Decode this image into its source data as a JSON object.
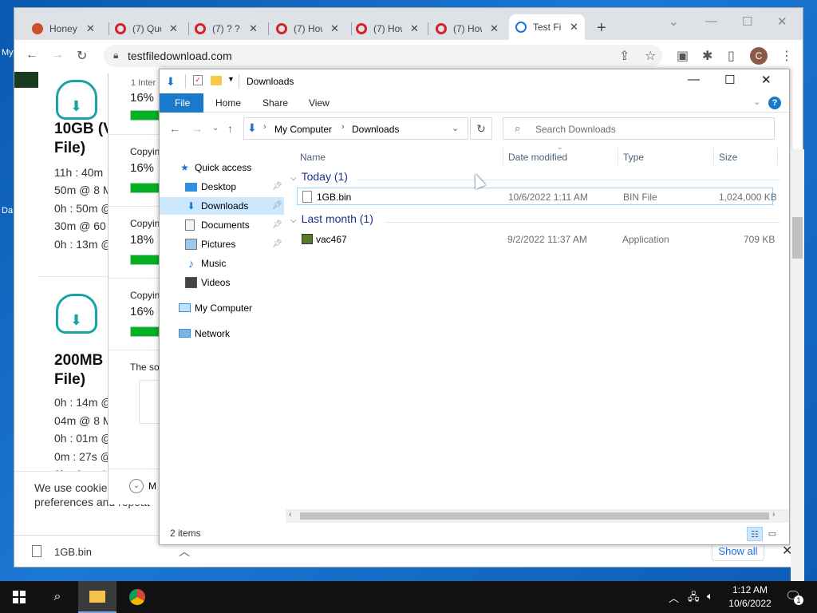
{
  "desktop": {
    "frag1": "My",
    "frag2": "Da"
  },
  "browser": {
    "tabs": [
      {
        "title": "Honey",
        "favicon_color": "#c9502b"
      },
      {
        "title": "(7) Quo",
        "favicon_color": "#d2232a"
      },
      {
        "title": "(7) ? ?",
        "favicon_color": "#d2232a"
      },
      {
        "title": "(7) How",
        "favicon_color": "#d2232a"
      },
      {
        "title": "(7) How",
        "favicon_color": "#d2232a"
      },
      {
        "title": "(7) How",
        "favicon_color": "#d2232a"
      },
      {
        "title": "Test Fil",
        "favicon_color": "#1a73e8"
      }
    ],
    "url": "testfiledownload.com",
    "profile_initial": "C"
  },
  "page": {
    "item1_title_line1": "10GB (V",
    "item1_title_line2": "File)",
    "item1_lines": [
      "11h : 40m",
      "50m @ 8 M",
      "0h : 50m @",
      "30m @ 60",
      "0h : 13m @"
    ],
    "item2_title_line1": "200MB",
    "item2_title_line2": "File)",
    "item2_lines": [
      "0h : 14m @",
      "04m @ 8 M",
      "0h : 01m @",
      "0m : 27s @",
      "0h : 0m : 1"
    ],
    "cookie_line1": "We use cookie",
    "cookie_line2": "preferences and repeat"
  },
  "copy_dialog": {
    "header": "1 Inter",
    "blocks": [
      {
        "label": "",
        "pct": "16%"
      },
      {
        "label": "Copyin",
        "pct": "16%"
      },
      {
        "label": "Copyin",
        "pct": "18%"
      },
      {
        "label": "Copyin",
        "pct": "16%"
      }
    ],
    "footer": "The sou",
    "more": "M"
  },
  "download_shelf": {
    "file": "1GB.bin",
    "show_all": "Show all"
  },
  "explorer": {
    "title": "Downloads",
    "ribbon_tabs": [
      "File",
      "Home",
      "Share",
      "View"
    ],
    "breadcrumb": [
      "My Computer",
      "Downloads"
    ],
    "search_placeholder": "Search Downloads",
    "nav": {
      "quick_access": "Quick access",
      "desktop": "Desktop",
      "downloads": "Downloads",
      "documents": "Documents",
      "pictures": "Pictures",
      "music": "Music",
      "videos": "Videos",
      "my_computer": "My Computer",
      "network": "Network"
    },
    "columns": [
      "Name",
      "Date modified",
      "Type",
      "Size"
    ],
    "groups": [
      {
        "label": "Today (1)",
        "files": [
          {
            "name": "1GB.bin",
            "date": "10/6/2022 1:11 AM",
            "type": "BIN File",
            "size": "1,024,000 KB"
          }
        ]
      },
      {
        "label": "Last month (1)",
        "files": [
          {
            "name": "vac467",
            "date": "9/2/2022 11:37 AM",
            "type": "Application",
            "size": "709 KB"
          }
        ]
      }
    ],
    "status": "2 items"
  },
  "taskbar": {
    "time": "1:12 AM",
    "date": "10/6/2022",
    "notifications": "1"
  }
}
